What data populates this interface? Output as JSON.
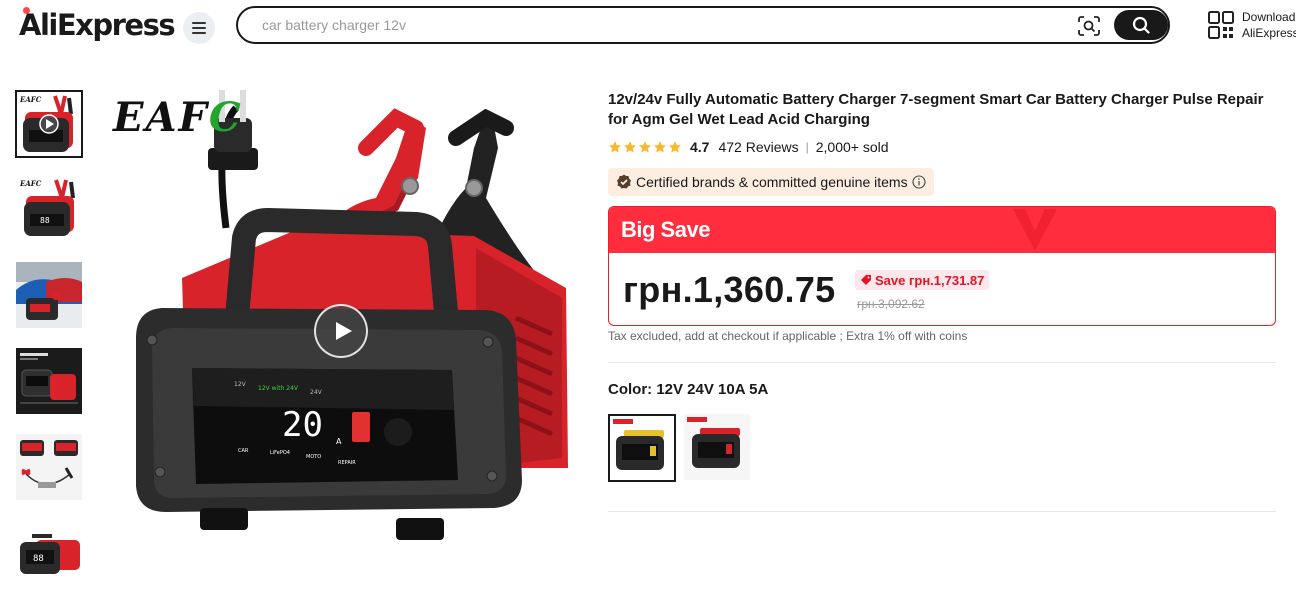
{
  "header": {
    "logo": "AliExpress",
    "search_placeholder": "car battery charger 12v",
    "download_line1": "Download",
    "download_line2": "AliExpress"
  },
  "gallery": {
    "thumbnail_count": 6,
    "brand_text_left": "EAF",
    "brand_text_c": "C"
  },
  "product": {
    "title": "12v/24v Fully Automatic Battery Charger 7-segment Smart Car Battery Charger Pulse Repair for Agm Gel Wet Lead Acid Charging",
    "rating": "4.7",
    "reviews": "472 Reviews",
    "sold": "2,000+ sold",
    "certified": "Certified brands & committed genuine items",
    "promo_label": "Big Save",
    "price": "грн.1,360.75",
    "save_text": "Save грн.1,731.87",
    "original_price": "грн.3,092.62",
    "tax_note": "Tax excluded, add at checkout if applicable ; Extra 1% off with coins",
    "color_label": "Color: 12V 24V 10A 5A"
  },
  "colors": {
    "accent_red": "#ff2d3d",
    "star_gold": "#f9b82a",
    "text_dark": "#191919"
  }
}
